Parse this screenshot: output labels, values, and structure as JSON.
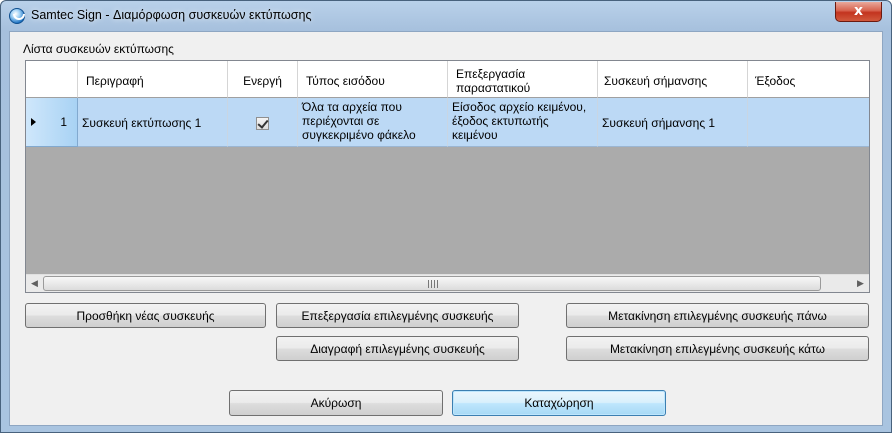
{
  "window": {
    "title": "Samtec Sign - Διαμόρφωση συσκευών εκτύπωσης",
    "close_glyph": "x",
    "icon": "samtec-sign-app-icon"
  },
  "group": {
    "label": "Λίστα συσκευών εκτύπωσης"
  },
  "grid": {
    "columns": [
      "Περιγραφή",
      "Ενεργή",
      "Τύπος εισόδου",
      "Επεξεργασία παραστατικού",
      "Συσκευή σήμανσης",
      "Έξοδος"
    ],
    "rows": [
      {
        "number": "1",
        "description": "Συσκευή εκτύπωσης 1",
        "active": true,
        "input_type": "Όλα τα αρχεία που περιέχονται σε συγκεκριμένο φάκελο",
        "document_processing": "Είσοδος αρχείο κειμένου, έξοδος εκτυπωτής κειμένου",
        "signing_device": "Συσκευή σήμανσης 1",
        "output": ""
      }
    ],
    "scroll_left_glyph": "◀",
    "scroll_right_glyph": "▶"
  },
  "buttons": {
    "add": "Προσθήκη νέας συσκευής",
    "edit": "Επεξεργασία επιλεγμένης συσκευής",
    "delete": "Διαγραφή επιλεγμένης συσκευής",
    "move_up": "Μετακίνηση επιλεγμένης συσκευής πάνω",
    "move_down": "Μετακίνηση επιλεγμένης συσκευής κάτω",
    "cancel": "Ακύρωση",
    "save": "Καταχώρηση"
  },
  "colors": {
    "selected_row": "#bcd9f5",
    "grid_empty": "#ababab",
    "close_button": "#c3341f",
    "default_button_border": "#3c7fb1"
  }
}
